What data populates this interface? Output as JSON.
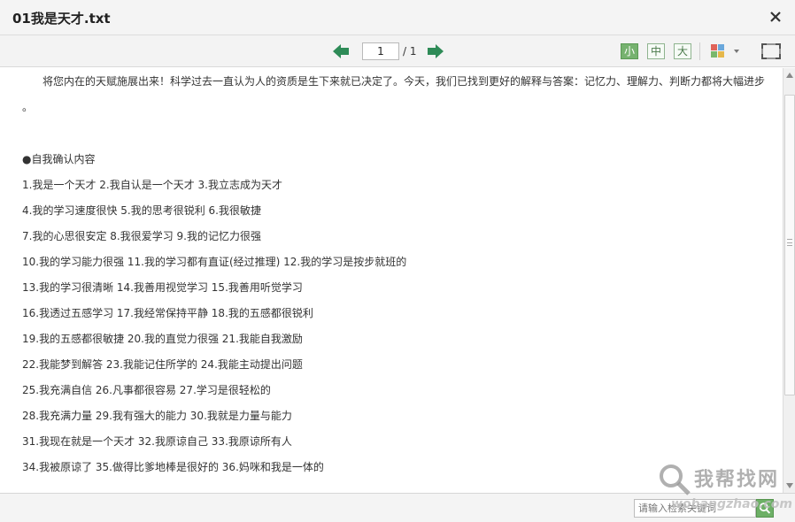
{
  "window": {
    "title": "01我是天才.txt",
    "close_icon": "close-icon"
  },
  "toolbar": {
    "prev_icon": "arrow-left-icon",
    "next_icon": "arrow-right-icon",
    "page_current": "1",
    "page_total": "/ 1",
    "font_sizes": [
      "小",
      "中",
      "大"
    ],
    "active_font_size": "小",
    "theme_icon": "color-grid-icon",
    "fullscreen_icon": "fullscreen-icon",
    "accent_color": "#76b26f",
    "arrow_color": "#2e8b57"
  },
  "document": {
    "intro_line1": "将您内在的天赋施展出来！科学过去一直认为人的资质是生下来就已决定了。今天，我们已找到更好的解释与答案：记忆力、理解力、判断力都将大幅进步",
    "intro_line2": "。",
    "heading": "●自我确认内容",
    "lines": [
      "1.我是一个天才 2.我自认是一个天才 3.我立志成为天才",
      "4.我的学习速度很快 5.我的思考很锐利 6.我很敏捷",
      "7.我的心思很安定 8.我很爱学习 9.我的记忆力很强",
      "10.我的学习能力很强 11.我的学习都有直证(经过推理) 12.我的学习是按步就班的",
      "13.我的学习很清晰 14.我善用视觉学习  15.我善用听觉学习",
      "16.我透过五感学习 17.我经常保持平静 18.我的五感都很锐利",
      "19.我的五感都很敏捷 20.我的直觉力很强 21.我能自我激励",
      "22.我能梦到解答 23.我能记住所学的 24.我能主动提出问题",
      "25.我充满自信 26.凡事都很容易 27.学习是很轻松的",
      "28.我充满力量 29.我有强大的能力 30.我就是力量与能力",
      "31.我现在就是一个天才 32.我原谅自己 33.我原谅所有人",
      "34.我被原谅了 35.做得比爹地棒是很好的 36.妈咪和我是一体的"
    ]
  },
  "search": {
    "placeholder": "请输入检索关键词",
    "icon": "search-icon"
  },
  "watermark": {
    "main": "我帮找网",
    "sub": "wobangzhao.com"
  }
}
